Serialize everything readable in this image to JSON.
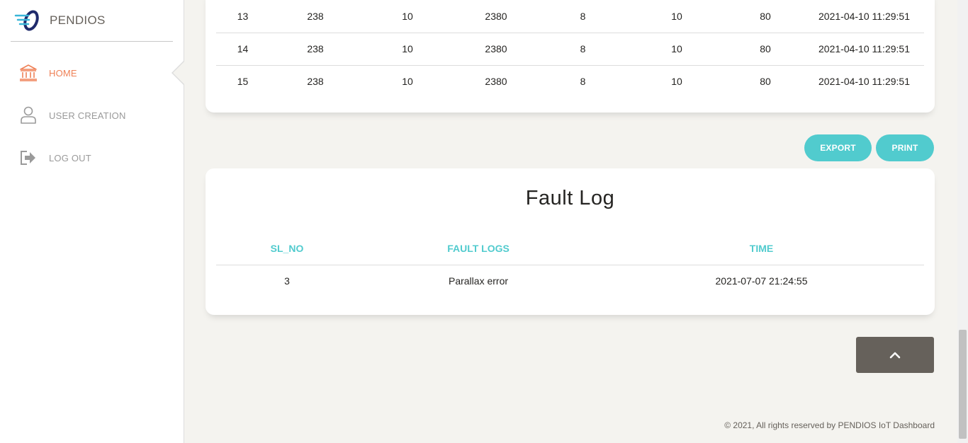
{
  "brand": {
    "name": "PENDIOS"
  },
  "sidebar": {
    "items": [
      {
        "label": "HOME",
        "icon": "bank-icon",
        "active": true
      },
      {
        "label": "USER CREATION",
        "icon": "user-icon",
        "active": false
      },
      {
        "label": "LOG OUT",
        "icon": "logout-icon",
        "active": false
      }
    ]
  },
  "data_table": {
    "rows": [
      [
        "13",
        "238",
        "10",
        "2380",
        "8",
        "10",
        "80",
        "2021-04-10 11:29:51"
      ],
      [
        "14",
        "238",
        "10",
        "2380",
        "8",
        "10",
        "80",
        "2021-04-10 11:29:51"
      ],
      [
        "15",
        "238",
        "10",
        "2380",
        "8",
        "10",
        "80",
        "2021-04-10 11:29:51"
      ]
    ]
  },
  "actions": {
    "export_label": "EXPORT",
    "print_label": "PRINT"
  },
  "fault_log": {
    "title": "Fault Log",
    "headers": [
      "SL_NO",
      "FAULT LOGS",
      "TIME"
    ],
    "rows": [
      [
        "3",
        "Parallax error",
        "2021-07-07 21:24:55"
      ]
    ]
  },
  "footer": {
    "text": "© 2021, All rights reserved by PENDIOS IoT Dashboard"
  },
  "colors": {
    "accent": "#51cbce",
    "active": "#ef8157",
    "dark": "#66615b"
  }
}
